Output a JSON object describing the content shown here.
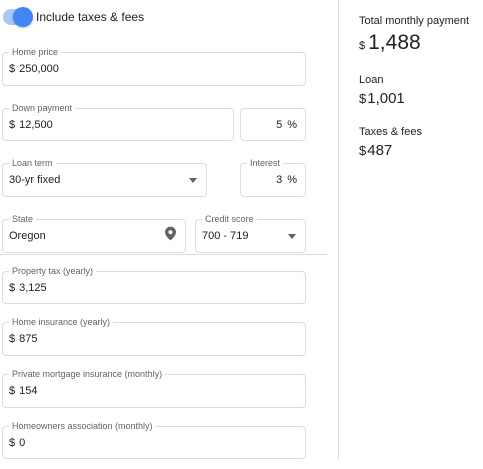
{
  "toggle": {
    "label": "Include taxes & fees",
    "on": true
  },
  "fields": {
    "home_price": {
      "label": "Home price",
      "currency": "$",
      "value": "250,000"
    },
    "down_payment": {
      "label": "Down payment",
      "currency": "$",
      "value": "12,500"
    },
    "down_payment_pct": {
      "value": "5",
      "unit": "%"
    },
    "loan_term": {
      "label": "Loan term",
      "value": "30-yr fixed"
    },
    "interest": {
      "label": "Interest",
      "value": "3",
      "unit": "%"
    },
    "state": {
      "label": "State",
      "value": "Oregon"
    },
    "credit_score": {
      "label": "Credit score",
      "value": "700 - 719"
    },
    "property_tax": {
      "label": "Property tax (yearly)",
      "currency": "$",
      "value": "3,125"
    },
    "home_insurance": {
      "label": "Home insurance (yearly)",
      "currency": "$",
      "value": "875"
    },
    "pmi": {
      "label": "Private mortgage insurance (monthly)",
      "currency": "$",
      "value": "154"
    },
    "hoa": {
      "label": "Homeowners association (monthly)",
      "currency": "$",
      "value": "0"
    }
  },
  "summary": {
    "total": {
      "label": "Total monthly payment",
      "currency": "$",
      "value": "1,488"
    },
    "loan": {
      "label": "Loan",
      "currency": "$",
      "value": "1,001"
    },
    "taxes": {
      "label": "Taxes & fees",
      "currency": "$",
      "value": "487"
    }
  },
  "colors": {
    "accent": "#4285f4",
    "accent_track": "#a8c7fa",
    "border": "#dadce0",
    "label": "#5f6368"
  },
  "icons": {
    "state": "location-pin-icon",
    "select": "chevron-down-icon"
  }
}
